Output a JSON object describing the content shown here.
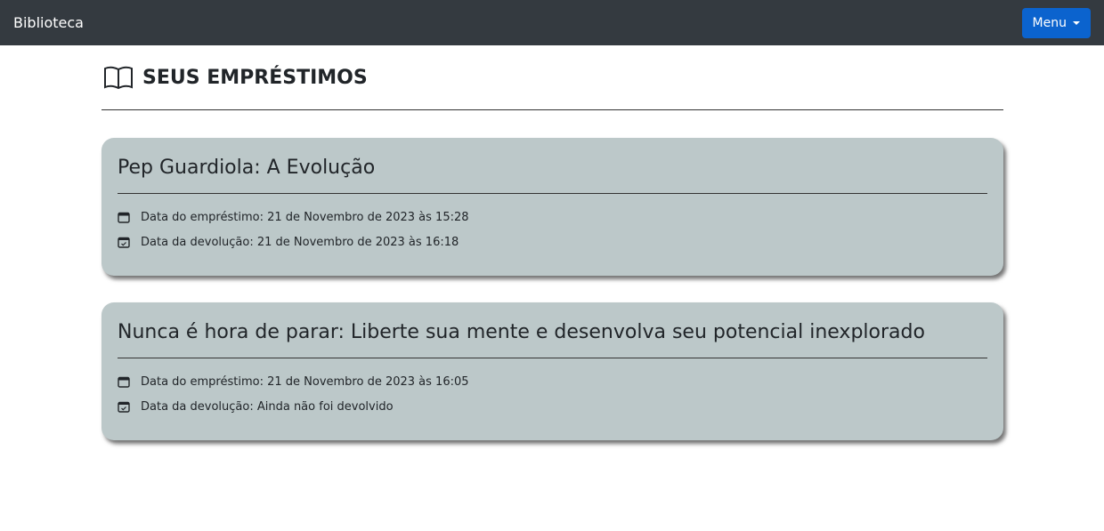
{
  "navbar": {
    "brand": "Biblioteca",
    "menu_label": "Menu",
    "menu_color": "#0b63ce"
  },
  "page": {
    "title": "SEUS EMPRÉSTIMOS",
    "title_icon": "book-open-icon"
  },
  "loans": [
    {
      "title": "Pep Guardiola: A Evolução",
      "loan_date": "Data do empréstimo: 21 de Novembro de 2023 às 15:28",
      "return_date": "Data da devolução: 21 de Novembro de 2023 às 16:18"
    },
    {
      "title": "Nunca é hora de parar: Liberte sua mente e desenvolva seu potencial inexplorado",
      "loan_date": "Data do empréstimo: 21 de Novembro de 2023 às 16:05",
      "return_date": "Data da devolução: Ainda não foi devolvido"
    }
  ]
}
